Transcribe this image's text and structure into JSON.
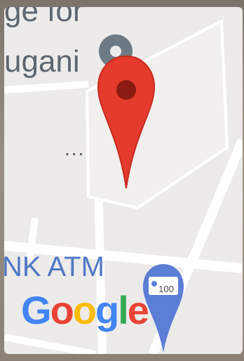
{
  "map": {
    "place_label_line1": "ge for",
    "place_label_line2": "ugani",
    "atm_label": "NK ATM",
    "overflow_dots": "...",
    "atm_badge": "100",
    "google_logo": [
      {
        "char": "G",
        "color": "#4285F4"
      },
      {
        "char": "o",
        "color": "#EA4335"
      },
      {
        "char": "o",
        "color": "#FBBC05"
      },
      {
        "char": "g",
        "color": "#4285F4"
      },
      {
        "char": "l",
        "color": "#34A853"
      },
      {
        "char": "e",
        "color": "#EA4335"
      }
    ],
    "icons": {
      "location_pin": "map-pin-icon",
      "atm_pin": "atm-pin-icon",
      "poi": "poi-marker-icon"
    },
    "colors": {
      "pin_red": "#e53b2c",
      "pin_dot": "#8a1a12",
      "atm_pin_blue": "#5c7ed6",
      "map_bg": "#ecebea",
      "road": "#ffffff"
    }
  }
}
